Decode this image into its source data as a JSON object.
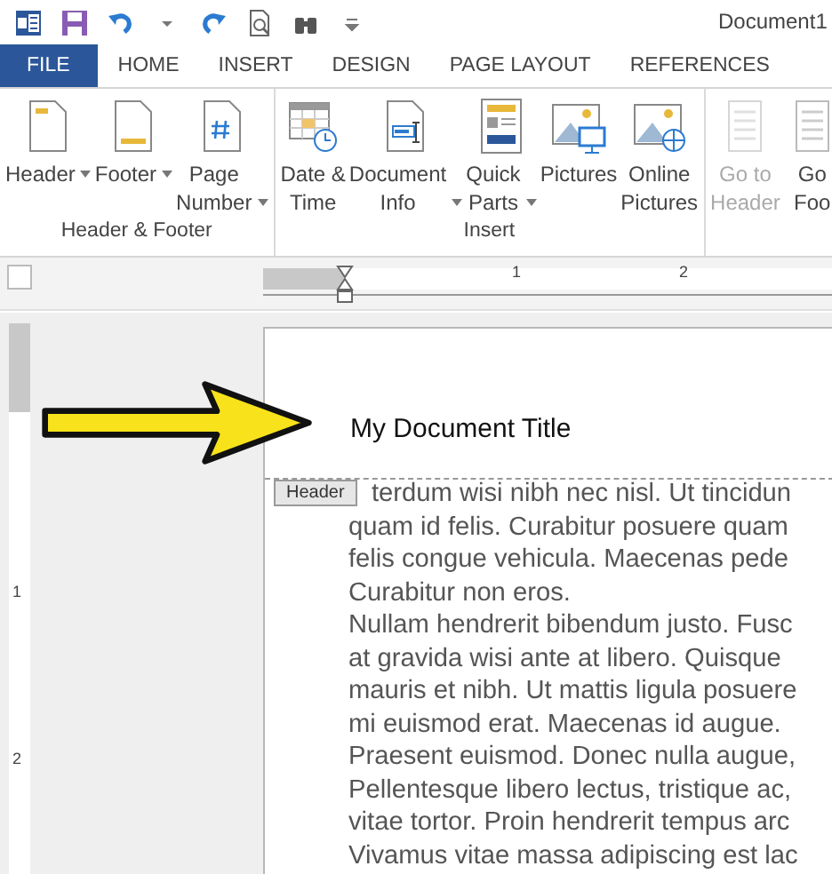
{
  "window": {
    "title": "Document1"
  },
  "quick_access": [
    {
      "kind": "word"
    },
    {
      "kind": "save"
    },
    {
      "kind": "undo"
    },
    {
      "kind": "caret"
    },
    {
      "kind": "redo"
    },
    {
      "kind": "preview"
    },
    {
      "kind": "find"
    },
    {
      "kind": "customize"
    }
  ],
  "tabs": [
    {
      "label": "FILE",
      "selected": false,
      "kind": "file"
    },
    {
      "label": "HOME",
      "selected": false,
      "kind": "tab"
    },
    {
      "label": "INSERT",
      "selected": false,
      "kind": "tab"
    },
    {
      "label": "DESIGN",
      "selected": false,
      "kind": "tab"
    },
    {
      "label": "PAGE LAYOUT",
      "selected": false,
      "kind": "tab"
    },
    {
      "label": "REFERENCES",
      "selected": false,
      "kind": "tab"
    }
  ],
  "ribbon_groups": [
    {
      "label": "Header & Footer",
      "buttons": [
        {
          "kind": "header",
          "lines": [
            "Header"
          ],
          "dropdown": true,
          "disabled": false
        },
        {
          "kind": "footer",
          "lines": [
            "Footer"
          ],
          "dropdown": true,
          "disabled": false
        },
        {
          "kind": "page-number",
          "lines": [
            "Page",
            "Number"
          ],
          "dropdown": true,
          "disabled": false
        }
      ]
    },
    {
      "label": "Insert",
      "buttons": [
        {
          "kind": "calendar",
          "lines": [
            "Date &",
            "Time"
          ],
          "dropdown": false,
          "disabled": false
        },
        {
          "kind": "doc-info",
          "lines": [
            "Document",
            "Info"
          ],
          "dropdown": true,
          "disabled": false
        },
        {
          "kind": "quick-parts",
          "lines": [
            "Quick",
            "Parts"
          ],
          "dropdown": true,
          "disabled": false
        },
        {
          "kind": "pictures",
          "lines": [
            "Pictures"
          ],
          "dropdown": false,
          "disabled": false
        },
        {
          "kind": "online-pictures",
          "lines": [
            "Online",
            "Pictures"
          ],
          "dropdown": false,
          "disabled": false
        }
      ]
    },
    {
      "buttons": [
        {
          "kind": "goto",
          "lines": [
            "Go to",
            "Header"
          ],
          "dropdown": false,
          "disabled": true
        },
        {
          "kind": "goto",
          "lines": [
            "Go",
            "Foo"
          ],
          "dropdown": false,
          "disabled": false
        }
      ]
    }
  ],
  "ruler": {
    "numbers": [
      "1",
      "2"
    ]
  },
  "vertical_ruler": {
    "numbers": [
      "1",
      "2"
    ]
  },
  "document": {
    "header_text": "My Document Title",
    "header_tag": "Header",
    "body_lines": [
      "terdum wisi nibh nec nisl. Ut tincidun",
      "quam id felis. Curabitur posuere quam",
      "felis congue vehicula. Maecenas pede",
      "Curabitur non eros.",
      "Nullam hendrerit bibendum justo. Fusc",
      "at gravida wisi ante at libero. Quisque",
      "mauris et nibh. Ut mattis ligula posuere",
      "mi euismod erat. Maecenas id augue.",
      "Praesent euismod. Donec nulla augue,",
      "Pellentesque libero lectus, tristique ac,",
      "vitae tortor. Proin hendrerit tempus arc",
      "Vivamus vitae massa adipiscing est lac"
    ]
  }
}
